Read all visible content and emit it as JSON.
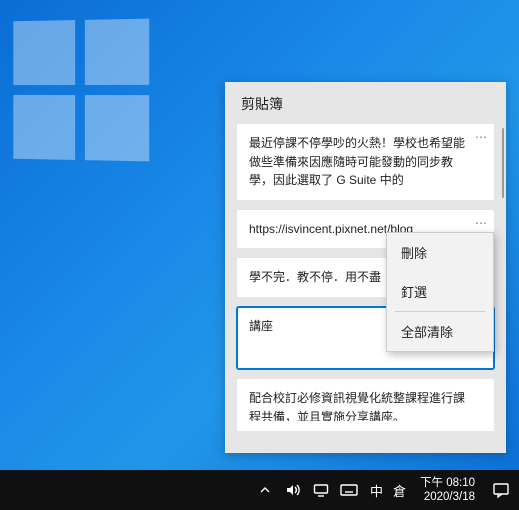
{
  "flyout": {
    "title": "剪貼簿",
    "items": [
      {
        "text": "最近停課不停學吵的火熱！學校也希望能做些準備來因應隨時可能發動的同步教學，因此選取了 G Suite 中的"
      },
      {
        "text": "https://isvincent.pixnet.net/blog"
      },
      {
        "text": "學不完．教不停．用不盡"
      },
      {
        "text": "講座"
      },
      {
        "text": "配合校訂必修資訊視覺化統整課程進行課程共備，並且實施分享講座。"
      }
    ]
  },
  "context_menu": {
    "delete": "刪除",
    "pin": "釘選",
    "clear_all": "全部清除"
  },
  "ime": {
    "lang": "中",
    "mode": "倉"
  },
  "clock": {
    "time": "下午 08:10",
    "date": "2020/3/18"
  }
}
